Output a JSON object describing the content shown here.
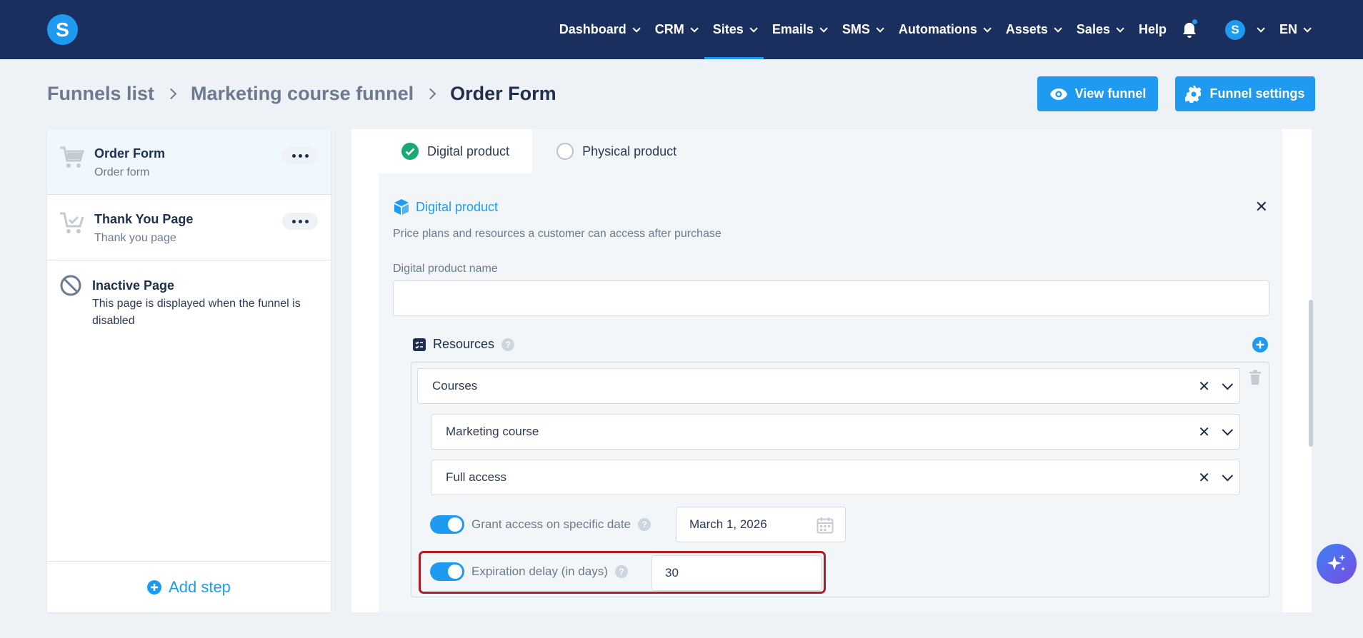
{
  "nav": {
    "items": [
      {
        "label": "Dashboard",
        "dropdown": true
      },
      {
        "label": "CRM",
        "dropdown": true
      },
      {
        "label": "Sites",
        "dropdown": true,
        "active": true
      },
      {
        "label": "Emails",
        "dropdown": true
      },
      {
        "label": "SMS",
        "dropdown": true
      },
      {
        "label": "Automations",
        "dropdown": true
      },
      {
        "label": "Assets",
        "dropdown": true
      },
      {
        "label": "Sales",
        "dropdown": true
      },
      {
        "label": "Help",
        "dropdown": false
      }
    ],
    "logo_letter": "S",
    "avatar_letter": "S",
    "language": "EN"
  },
  "breadcrumb": {
    "items": [
      "Funnels list",
      "Marketing course funnel",
      "Order Form"
    ]
  },
  "header": {
    "view_funnel": "View funnel",
    "funnel_settings": "Funnel settings"
  },
  "steps": {
    "items": [
      {
        "title": "Order Form",
        "subtitle": "Order form",
        "icon": "cart-icon"
      },
      {
        "title": "Thank You Page",
        "subtitle": "Thank you page",
        "icon": "cart-check-icon"
      }
    ],
    "inactive_title": "Inactive Page",
    "inactive_subtitle": "This page is displayed when the funnel is disabled",
    "add_step": "Add step"
  },
  "product": {
    "tabs": [
      "Digital product",
      "Physical product"
    ],
    "title": "Digital product",
    "description": "Price plans and resources a customer can access after purchase",
    "name_label": "Digital product name",
    "name_value": "",
    "resources_label": "Resources",
    "help_glyph": "?",
    "selects": [
      "Courses",
      "Marketing course",
      "Full access"
    ],
    "grant_label": "Grant access on specific date",
    "grant_date": "March 1, 2026",
    "expiration_label": "Expiration delay (in days)",
    "expiration_value": "30"
  },
  "colors": {
    "nav_bg": "#1a2f5e",
    "accent": "#1e9bf0",
    "highlight": "#b01e23",
    "success": "#19a974"
  }
}
